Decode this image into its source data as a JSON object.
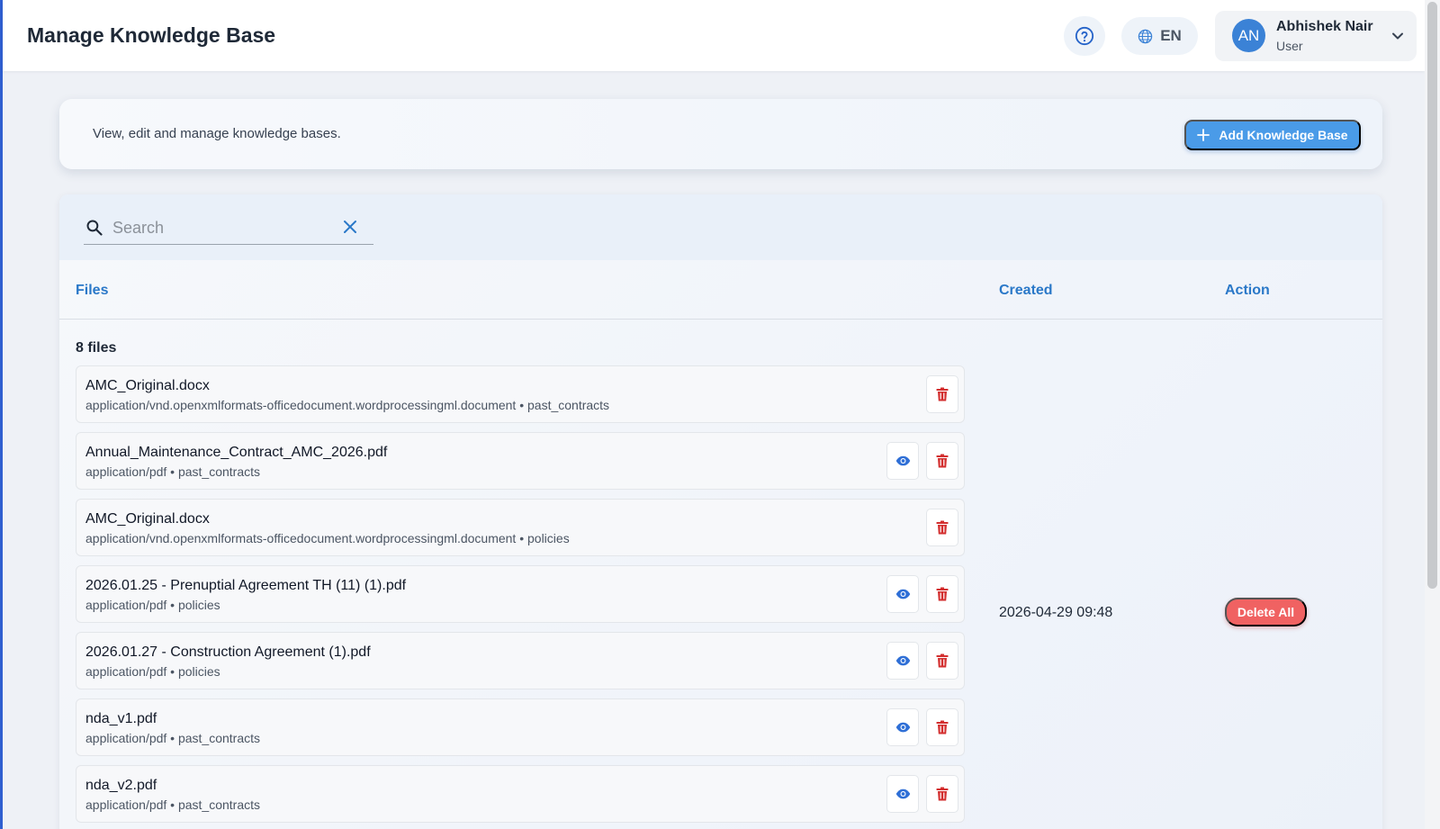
{
  "header": {
    "title": "Manage Knowledge Base",
    "language": "EN",
    "user": {
      "initials": "AN",
      "name": "Abhishek Nair",
      "role": "User"
    }
  },
  "intro": {
    "description": "View, edit and manage knowledge bases.",
    "add_button_label": "Add Knowledge Base"
  },
  "search": {
    "placeholder": "Search",
    "value": ""
  },
  "table": {
    "columns": {
      "files": "Files",
      "created": "Created",
      "action": "Action"
    },
    "files_count": "8 files",
    "created": "2026-04-29 09:48",
    "delete_all_label": "Delete All",
    "files": [
      {
        "name": "AMC_Original.docx",
        "meta": "application/vnd.openxmlformats-officedocument.wordprocessingml.document • past_contracts",
        "viewable": false
      },
      {
        "name": "Annual_Maintenance_Contract_AMC_2026.pdf",
        "meta": "application/pdf • past_contracts",
        "viewable": true
      },
      {
        "name": "AMC_Original.docx",
        "meta": "application/vnd.openxmlformats-officedocument.wordprocessingml.document • policies",
        "viewable": false
      },
      {
        "name": "2026.01.25 - Prenuptial Agreement TH (11) (1).pdf",
        "meta": "application/pdf • policies",
        "viewable": true
      },
      {
        "name": "2026.01.27 - Construction Agreement (1).pdf",
        "meta": "application/pdf • policies",
        "viewable": true
      },
      {
        "name": "nda_v1.pdf",
        "meta": "application/pdf • past_contracts",
        "viewable": true
      },
      {
        "name": "nda_v2.pdf",
        "meta": "application/pdf • past_contracts",
        "viewable": true
      }
    ]
  },
  "colors": {
    "accent": "#2a78c8",
    "primary_button": "#4a9be8",
    "danger": "#f06262",
    "delete_icon": "#d32f2f",
    "view_icon": "#2f6fd6"
  }
}
